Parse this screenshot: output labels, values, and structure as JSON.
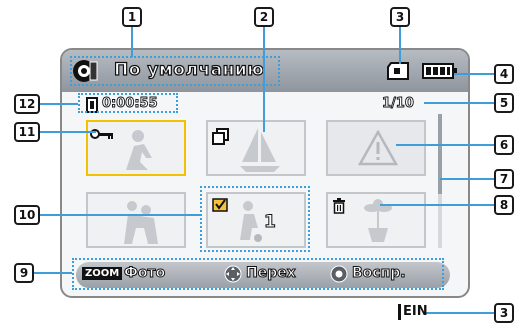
{
  "header": {
    "title": "По умолчанию"
  },
  "info": {
    "time": "0:00:55",
    "page": "1/10"
  },
  "thumb5": {
    "count": "1"
  },
  "bottom": {
    "zoom": "ZOOM",
    "photo": "Фото",
    "move": "Перех",
    "play": "Воспр."
  },
  "corner_badge": "EIN",
  "callouts": [
    "1",
    "2",
    "3",
    "4",
    "5",
    "6",
    "7",
    "8",
    "9",
    "10",
    "11",
    "12",
    "3"
  ],
  "colors": {
    "selection": "#f2c200",
    "dotted": "#3f9ed8",
    "bar": "#9aa0a7"
  },
  "icons": [
    "movie-mode-icon",
    "memory-card-icon",
    "battery-icon",
    "film-icon",
    "key-icon",
    "copy-icon",
    "warning-icon",
    "trash-icon",
    "check-icon",
    "dpad-icon",
    "ok-button-icon"
  ]
}
